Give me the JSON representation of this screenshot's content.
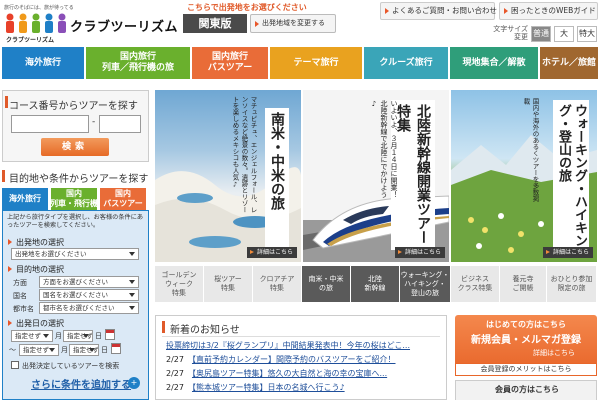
{
  "header": {
    "tagline": "旅行のそばには、旅が待ってる",
    "logo_sub": "クラブツーリズム",
    "logo_text": "クラブツーリズム",
    "region_note": "こちらで出発地をお選びください",
    "region_name": "関東版",
    "region_change": "出発地域を変更する",
    "faq": "よくあるご質問・お問い合わせ",
    "guide": "困ったときのWEBガイド",
    "fontsize_label": "文字サイズ変更",
    "fontsize": [
      "普通",
      "大",
      "特大"
    ]
  },
  "nav": [
    {
      "label": "海外旅行",
      "color": "#1f80c7"
    },
    {
      "label": "国内旅行\n列車／飛行機の旅",
      "color": "#6ab02d"
    },
    {
      "label": "国内旅行\nバスツアー",
      "color": "#e96c38"
    },
    {
      "label": "テーマ旅行",
      "color": "#e9a21f"
    },
    {
      "label": "クルーズ旅行",
      "color": "#3aa5b8"
    },
    {
      "label": "現地集合／解散",
      "color": "#2f9e7a"
    },
    {
      "label": "ホテル／旅館",
      "color": "#a0672f"
    }
  ],
  "course": {
    "title": "コース番号からツアーを探す",
    "dash": "-",
    "search": "検索"
  },
  "purpose": {
    "title": "目的地や条件からツアーを探す",
    "tabs": [
      "海外旅行",
      "国内\n列車・飛行機",
      "国内\nバスツアー"
    ],
    "note": "上記から旅行タイプを選択し、お客様の条件にあったツアーを検索してください。",
    "departure_label": "出発地の選択",
    "departure_value": "出発地をお選びください",
    "destination_label": "目的地の選択",
    "dest_rows": [
      {
        "label": "方面",
        "value": "方面をお選びください"
      },
      {
        "label": "国名",
        "value": "国名をお選びください"
      },
      {
        "label": "都市名",
        "value": "都市名をお選びください"
      }
    ],
    "date_label": "出発日の選択",
    "date_row1": {
      "year": "指定せず",
      "month_unit": "月",
      "day": "指定せず",
      "day_unit": "日"
    },
    "date_row2": {
      "tilde": "〜",
      "year": "指定せず",
      "month_unit": "月",
      "day": "指定せず",
      "day_unit": "日"
    },
    "undecided": "出発決定しているツアーを検索",
    "more": "さらに条件を追加する",
    "more_icon": "+"
  },
  "hero": [
    {
      "title": "南米・中米の旅",
      "desc": "マチュピチュ、エンジェルフォール、レンソイスなど絶景の数々。遺跡とリゾートを楽しめるメキシコも人気♪",
      "detail": "詳細はこちら",
      "bg": "#a6c8e2"
    },
    {
      "title": "北陸新幹線開業ツアー特集",
      "desc": "いよいよ、３月１４日に開業！北陸新幹線で北陸にでかけよう♪",
      "detail": "詳細はこちら",
      "bg": "#f2f2f2"
    },
    {
      "title": "ウォーキング・ハイキング・登山の旅",
      "desc": "国内や海外のあるくツアーを多数掲載",
      "detail": "詳細はこちら",
      "bg": "#b9d9ee"
    }
  ],
  "subtabs": [
    "ゴールデン\nウィーク\n特集",
    "桜ツアー\n特集",
    "クロアチア\n特集",
    "南米・中米\nの旅",
    "北陸\n新幹線",
    "ウォーキング・\nハイキング・\n登山の旅",
    "ビジネス\nクラス特集",
    "養元寺\nご開帳",
    "おひとり参加\n限定の旅"
  ],
  "news": {
    "title": "新着のお知らせ",
    "items": [
      {
        "date": "",
        "text": "投票締切は3/2『桜グランプリ』中間結果発表中！今年の桜はどこ..."
      },
      {
        "date": "2/27",
        "text": "【直前予約カレンダー】間際予約のバスツアーをご紹介！"
      },
      {
        "date": "2/27",
        "text": "【奥尻島ツアー特集】悠久の大自然と海の幸の宝庫へ..."
      },
      {
        "date": "2/27",
        "text": "【熊本城ツアー特集】日本の名城へ行こう♪"
      }
    ]
  },
  "promo": {
    "title": "はじめての方はこちら",
    "register": "新規会員・メルマガ登録",
    "detail": "詳細はこちら",
    "merit": "会員登録のメリットはこちら",
    "login_title": "会員の方はこちら"
  }
}
